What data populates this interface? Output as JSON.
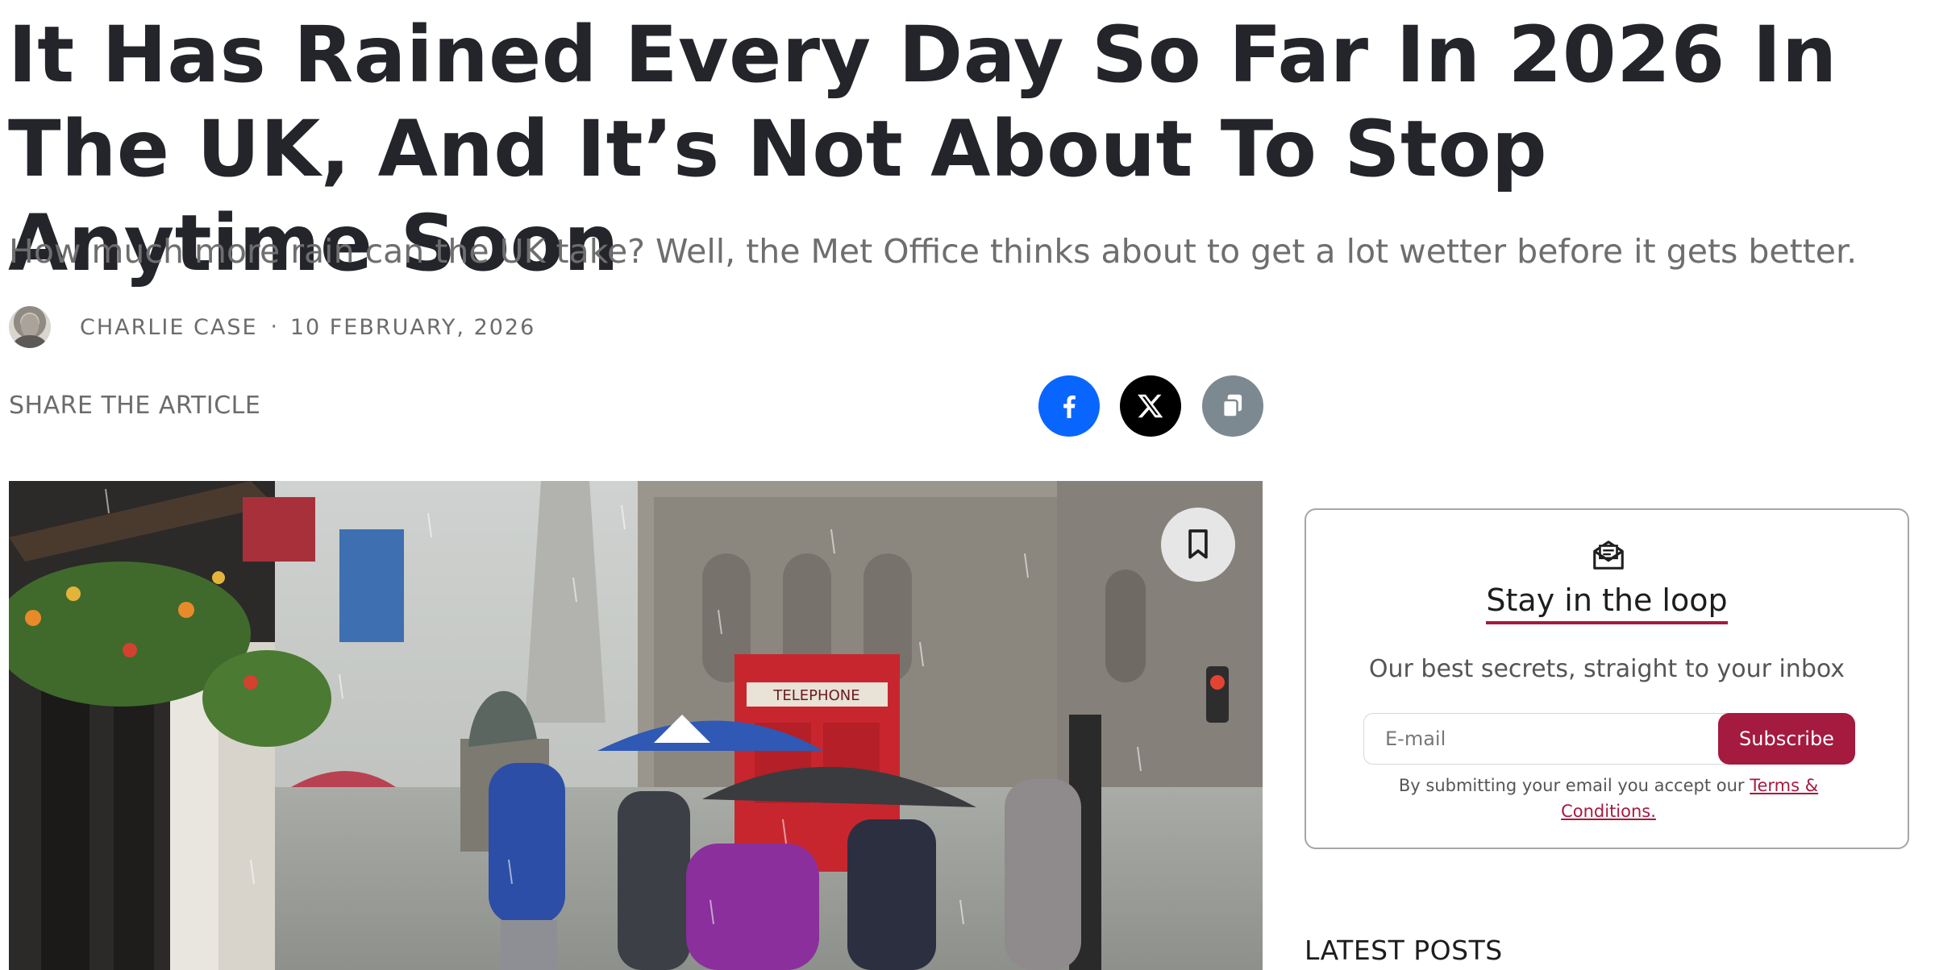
{
  "article": {
    "headline": "It Has Rained Every Day So Far In 2026 In The UK, And It’s Not About To Stop Anytime Soon",
    "subheadline": "How much more rain can the UK take? Well, the Met Office thinks about to get a lot wetter before it gets better.",
    "author": "CHARLIE CASE",
    "separator": "·",
    "date": "10 FEBRUARY, 2026"
  },
  "share": {
    "label": "SHARE THE ARTICLE",
    "buttons": [
      {
        "icon": "facebook-icon",
        "color": "#0866ff"
      },
      {
        "icon": "x-icon",
        "color": "#000000"
      },
      {
        "icon": "copy-icon",
        "color": "#7d8991"
      }
    ]
  },
  "hero": {
    "bookmark_icon": "bookmark-icon",
    "sign_text": "TELEPHONE"
  },
  "newsletter": {
    "icon": "mail-icon",
    "title": "Stay in the loop",
    "subtitle": "Our best secrets, straight to your inbox",
    "input_placeholder": "E-mail",
    "button_label": "Subscribe",
    "terms_prefix": "By submitting your email you accept our ",
    "terms_link": "Terms & Conditions.",
    "accent_color": "#a51a3f"
  },
  "sidebar": {
    "latest_posts_heading": "LATEST POSTS"
  }
}
